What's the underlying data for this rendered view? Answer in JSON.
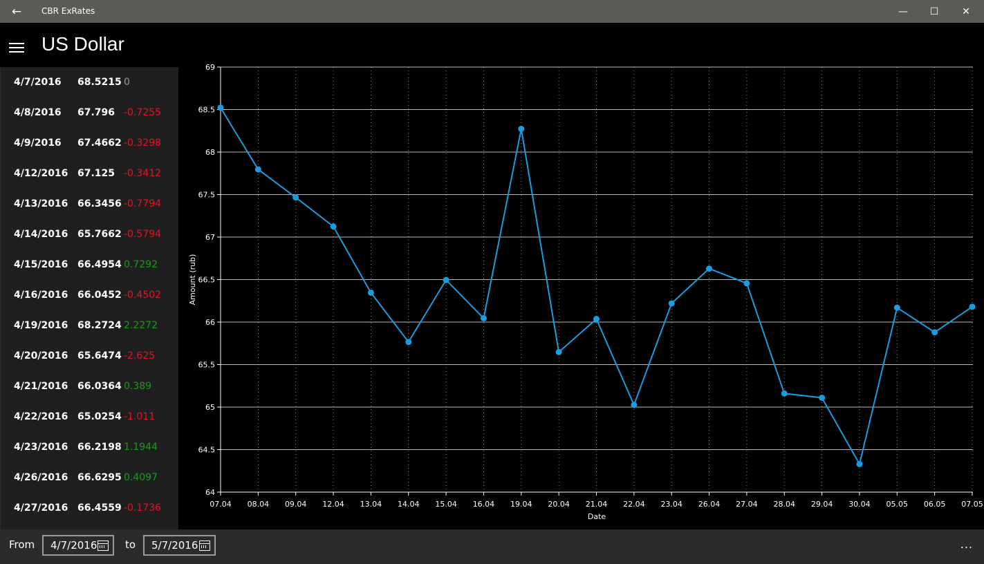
{
  "window": {
    "title": "CBR ExRates",
    "back_icon": "←",
    "minimize_icon": "—",
    "maximize_icon": "☐",
    "close_icon": "✕"
  },
  "header": {
    "title": "US Dollar"
  },
  "rates": [
    {
      "date": "4/7/2016",
      "rate": "68.5215",
      "diff": "0",
      "trend": "zero"
    },
    {
      "date": "4/8/2016",
      "rate": "67.796",
      "diff": "-0.7255",
      "trend": "neg"
    },
    {
      "date": "4/9/2016",
      "rate": "67.4662",
      "diff": "-0.3298",
      "trend": "neg"
    },
    {
      "date": "4/12/2016",
      "rate": "67.125",
      "diff": "-0.3412",
      "trend": "neg"
    },
    {
      "date": "4/13/2016",
      "rate": "66.3456",
      "diff": "-0.7794",
      "trend": "neg"
    },
    {
      "date": "4/14/2016",
      "rate": "65.7662",
      "diff": "-0.5794",
      "trend": "neg"
    },
    {
      "date": "4/15/2016",
      "rate": "66.4954",
      "diff": "0.7292",
      "trend": "pos"
    },
    {
      "date": "4/16/2016",
      "rate": "66.0452",
      "diff": "-0.4502",
      "trend": "neg"
    },
    {
      "date": "4/19/2016",
      "rate": "68.2724",
      "diff": "2.2272",
      "trend": "pos"
    },
    {
      "date": "4/20/2016",
      "rate": "65.6474",
      "diff": "-2.625",
      "trend": "neg"
    },
    {
      "date": "4/21/2016",
      "rate": "66.0364",
      "diff": "0.389",
      "trend": "pos"
    },
    {
      "date": "4/22/2016",
      "rate": "65.0254",
      "diff": "-1.011",
      "trend": "neg"
    },
    {
      "date": "4/23/2016",
      "rate": "66.2198",
      "diff": "1.1944",
      "trend": "pos"
    },
    {
      "date": "4/26/2016",
      "rate": "66.6295",
      "diff": "0.4097",
      "trend": "pos"
    },
    {
      "date": "4/27/2016",
      "rate": "66.4559",
      "diff": "-0.1736",
      "trend": "neg"
    }
  ],
  "chart_data": {
    "type": "line",
    "categories": [
      "07.04",
      "08.04",
      "09.04",
      "12.04",
      "13.04",
      "14.04",
      "15.04",
      "16.04",
      "19.04",
      "20.04",
      "21.04",
      "22.04",
      "23.04",
      "26.04",
      "27.04",
      "28.04",
      "29.04",
      "30.04",
      "05.05",
      "06.05",
      "07.05"
    ],
    "series": [
      {
        "values": [
          68.5215,
          67.796,
          67.4662,
          67.125,
          66.3456,
          65.7662,
          66.4954,
          66.0452,
          68.2724,
          65.6474,
          66.0364,
          65.0254,
          66.2198,
          66.6295,
          66.4559,
          65.16,
          65.11,
          64.33,
          66.17,
          65.88,
          66.18
        ]
      }
    ],
    "xlabel": "Date",
    "ylabel": "Amount (rub)",
    "ylim": [
      64,
      69
    ],
    "yticks": [
      "64",
      "64.5",
      "65",
      "65.5",
      "66",
      "66.5",
      "67",
      "67.5",
      "68",
      "68.5",
      "69"
    ],
    "grid": true,
    "color": "#1a9de0"
  },
  "footer": {
    "from_label": "From",
    "from_date": "4/7/2016",
    "to_label": "to",
    "to_date": "5/7/2016",
    "more_label": "..."
  }
}
